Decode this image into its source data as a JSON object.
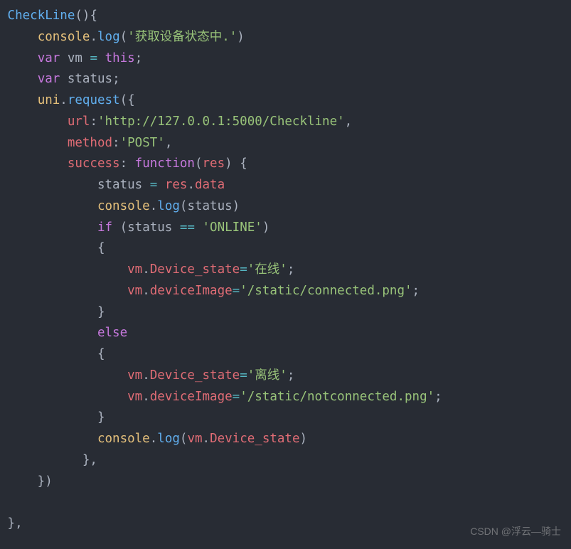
{
  "code": {
    "fn_name": "CheckLine",
    "log1": "'获取设备状态中.'",
    "var_vm": "vm",
    "var_status": "status",
    "url_key": "url",
    "url_val": "'http://127.0.0.1:5000/Checkline'",
    "method_key": "method",
    "method_val": "'POST'",
    "success_key": "success",
    "param_res": "res",
    "cmp_val": "'ONLINE'",
    "dev_state_on": "'在线'",
    "dev_img_on": "'/static/connected.png'",
    "dev_state_off": "'离线'",
    "dev_img_off": "'/static/notconnected.png'",
    "prop_device_state": "Device_state",
    "prop_device_image": "deviceImage",
    "kw_var": "var",
    "kw_this": "this",
    "kw_function": "function",
    "kw_if": "if",
    "kw_else": "else",
    "obj_console": "console",
    "obj_uni": "uni",
    "m_log": "log",
    "m_request": "request",
    "p_data": "data"
  },
  "watermark": "CSDN @浮云—骑士"
}
